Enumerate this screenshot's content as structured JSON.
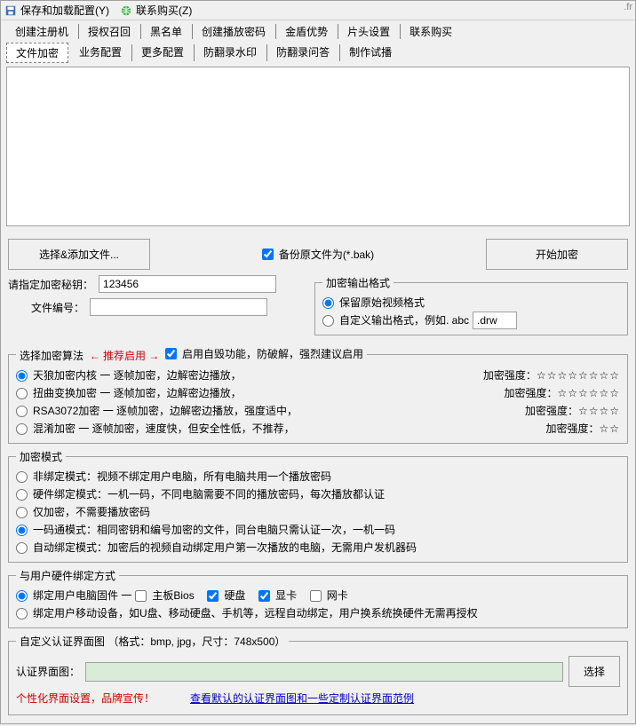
{
  "top_right_hint": ".fr",
  "menu": {
    "save_load": "保存和加载配置(Y)",
    "contact": "联系购买(Z)"
  },
  "tabs_row1": [
    "创建注册机",
    "授权召回",
    "黑名单",
    "创建播放密码",
    "金盾优势",
    "片头设置",
    "联系购买"
  ],
  "tabs_row2": [
    "文件加密",
    "业务配置",
    "更多配置",
    "防翻录水印",
    "防翻录问答",
    "制作试播"
  ],
  "active_tab_row2_index": 0,
  "buttons": {
    "select_files": "选择&添加文件...",
    "start_encrypt": "开始加密",
    "choose": "选择"
  },
  "backup": {
    "label": "备份原文件为(*.bak)",
    "checked": true
  },
  "key": {
    "label": "请指定加密秘钥：",
    "value": "123456"
  },
  "file_no": {
    "label": "文件编号：",
    "value": ""
  },
  "output": {
    "legend": "加密输出格式",
    "keep": "保留原始视频格式",
    "custom": "自定义输出格式，例如. abc",
    "ext": ".drw",
    "selected": "keep"
  },
  "algo": {
    "legend": "选择加密算法",
    "rec": "← 推荐启用 →",
    "self_destroy_label": "启用自毁功能，防破解，强烈建议启用",
    "self_destroy_checked": true,
    "strength_label": "加密强度：",
    "items": [
      {
        "name": "天狼加密内核",
        "desc": " 一 逐帧加密，边解密边播放，",
        "stars": "☆☆☆☆☆☆☆☆",
        "selected": true
      },
      {
        "name": "扭曲变换加密",
        "desc": " 一 逐帧加密，边解密边播放，",
        "stars": "☆☆☆☆☆☆",
        "selected": false
      },
      {
        "name": "RSA3072加密",
        "desc": " 一 逐帧加密，边解密边播放，强度适中，",
        "stars": "☆☆☆☆",
        "selected": false
      },
      {
        "name": "混淆加密",
        "desc": " 一 逐帧加密，速度快，但安全性低，不推荐，",
        "stars": "☆☆",
        "selected": false
      }
    ]
  },
  "mode": {
    "legend": "加密模式",
    "items": [
      {
        "text": "非绑定模式：视频不绑定用户电脑，所有电脑共用一个播放密码",
        "selected": false
      },
      {
        "text": "硬件绑定模式：一机一码，不同电脑需要不同的播放密码，每次播放都认证",
        "selected": false
      },
      {
        "text": "仅加密，不需要播放密码",
        "selected": false
      },
      {
        "text": "一码通模式：相同密钥和编号加密的文件，同台电脑只需认证一次，一机一码",
        "selected": true
      },
      {
        "text": "自动绑定模式：加密后的视频自动绑定用户第一次播放的电脑，无需用户发机器码",
        "selected": false
      }
    ]
  },
  "hw": {
    "legend": "与用户硬件绑定方式",
    "fw_label": "绑定用户电脑固件 一",
    "fw_selected": true,
    "bios": {
      "label": "主板Bios",
      "checked": false
    },
    "hdd": {
      "label": "硬盘",
      "checked": true
    },
    "gpu": {
      "label": "显卡",
      "checked": true
    },
    "nic": {
      "label": "网卡",
      "checked": false
    },
    "mobile_label": "绑定用户移动设备，如U盘、移动硬盘、手机等，远程自动绑定，用户换系统换硬件无需再授权",
    "mobile_selected": false
  },
  "authimg": {
    "legend": "自定义认证界面图 （格式：bmp, jpg，尺寸：748x500）",
    "label": "认证界面图：",
    "value": "",
    "tip": "个性化界面设置，品牌宣传！",
    "link": "查看默认的认证界面图和一些定制认证界面范例"
  }
}
